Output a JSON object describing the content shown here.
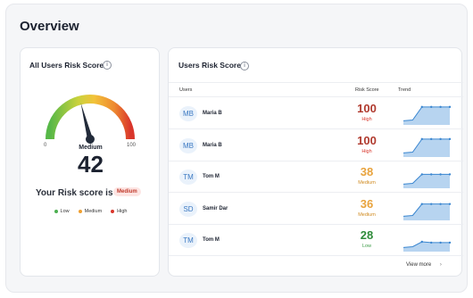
{
  "page": {
    "title": "Overview"
  },
  "left_card": {
    "title": "All Users Risk Score",
    "gauge": {
      "min_label": "0",
      "max_label": "100",
      "value": 42,
      "value_text": "42",
      "level": "Medium"
    },
    "your_score_label": "Your Risk score is",
    "your_score_badge": "Medium",
    "legend": [
      {
        "label": "Low",
        "color": "#4caf50"
      },
      {
        "label": "Medium",
        "color": "#f0a030"
      },
      {
        "label": "High",
        "color": "#d9362b"
      }
    ]
  },
  "right_card": {
    "title": "Users Risk Score",
    "columns": {
      "users": "Users",
      "risk_score": "Risk Score",
      "trend": "Trend"
    },
    "rows": [
      {
        "initials": "MB",
        "name": "Maria B",
        "score": "100",
        "level": "High",
        "score_color": "#b03a2e",
        "level_color": "#d9362b",
        "trend": [
          5,
          6,
          22,
          22,
          22,
          22
        ]
      },
      {
        "initials": "MB",
        "name": "Maria B",
        "score": "100",
        "level": "High",
        "score_color": "#b03a2e",
        "level_color": "#d9362b",
        "trend": [
          5,
          6,
          22,
          22,
          22,
          22
        ]
      },
      {
        "initials": "TM",
        "name": "Tom M",
        "score": "38",
        "level": "Medium",
        "score_color": "#e8a33d",
        "level_color": "#d08a1f",
        "trend": [
          5,
          6,
          17,
          17,
          17,
          17
        ]
      },
      {
        "initials": "SD",
        "name": "Samir Dar",
        "score": "36",
        "level": "Medium",
        "score_color": "#e8a33d",
        "level_color": "#d08a1f",
        "trend": [
          5,
          6,
          20,
          20,
          20,
          20
        ]
      },
      {
        "initials": "TM",
        "name": "Tom M",
        "score": "28",
        "level": "Low",
        "score_color": "#2e8b3a",
        "level_color": "#3a9a45",
        "trend": [
          5,
          6,
          12,
          11,
          11,
          11
        ]
      }
    ],
    "view_more": "View more"
  }
}
